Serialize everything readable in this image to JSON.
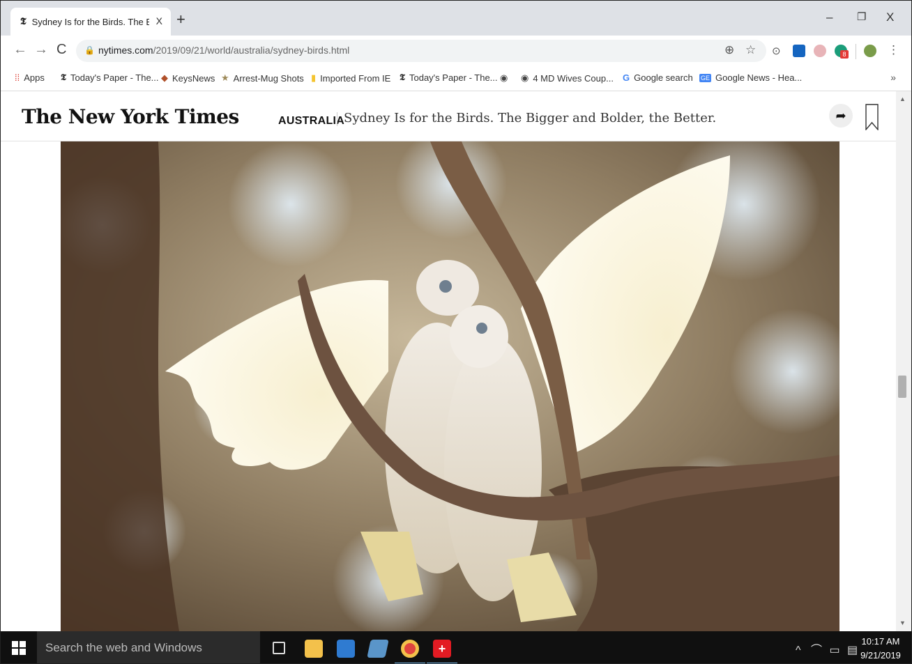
{
  "browser": {
    "tab_title": "Sydney Is for the Birds. The Bigge",
    "tab_close": "X",
    "new_tab": "+",
    "window": {
      "minimize": "–",
      "restore": "❐",
      "close": "X"
    },
    "url_domain": "nytimes.com",
    "url_path": "/2019/09/21/world/australia/sydney-birds.html"
  },
  "bookmarks": [
    {
      "label": "Apps",
      "icon": "apps-grid-icon"
    },
    {
      "label": "Today's Paper - The...",
      "icon": "nyt-icon"
    },
    {
      "label": "KeysNews",
      "icon": "keysnews-icon"
    },
    {
      "label": "Arrest-Mug Shots",
      "icon": "star-icon"
    },
    {
      "label": "Imported From IE",
      "icon": "folder-icon"
    },
    {
      "label": "Today's Paper - The...",
      "icon": "nyt-icon"
    },
    {
      "label": "",
      "icon": "globe-icon"
    },
    {
      "label": "4 MD Wives Coup...",
      "icon": "globe-icon"
    },
    {
      "label": "Google search",
      "icon": "google-icon"
    },
    {
      "label": "Google News - Hea...",
      "icon": "google-news-icon"
    }
  ],
  "bookmarks_more": "»",
  "ext_badge": "8",
  "nyt": {
    "logo": "The New York Times",
    "section": "AUSTRALIA",
    "headline": "Sydney Is for the Birds. The Bigger and Bolder, the Better."
  },
  "taskbar": {
    "search_placeholder": "Search the web and Windows",
    "time": "10:17 AM",
    "date": "9/21/2019"
  },
  "colors": {
    "chrome_tabstrip": "#dee1e6",
    "taskbar": "#101010",
    "taskbar_accent": "#76b9ed"
  }
}
